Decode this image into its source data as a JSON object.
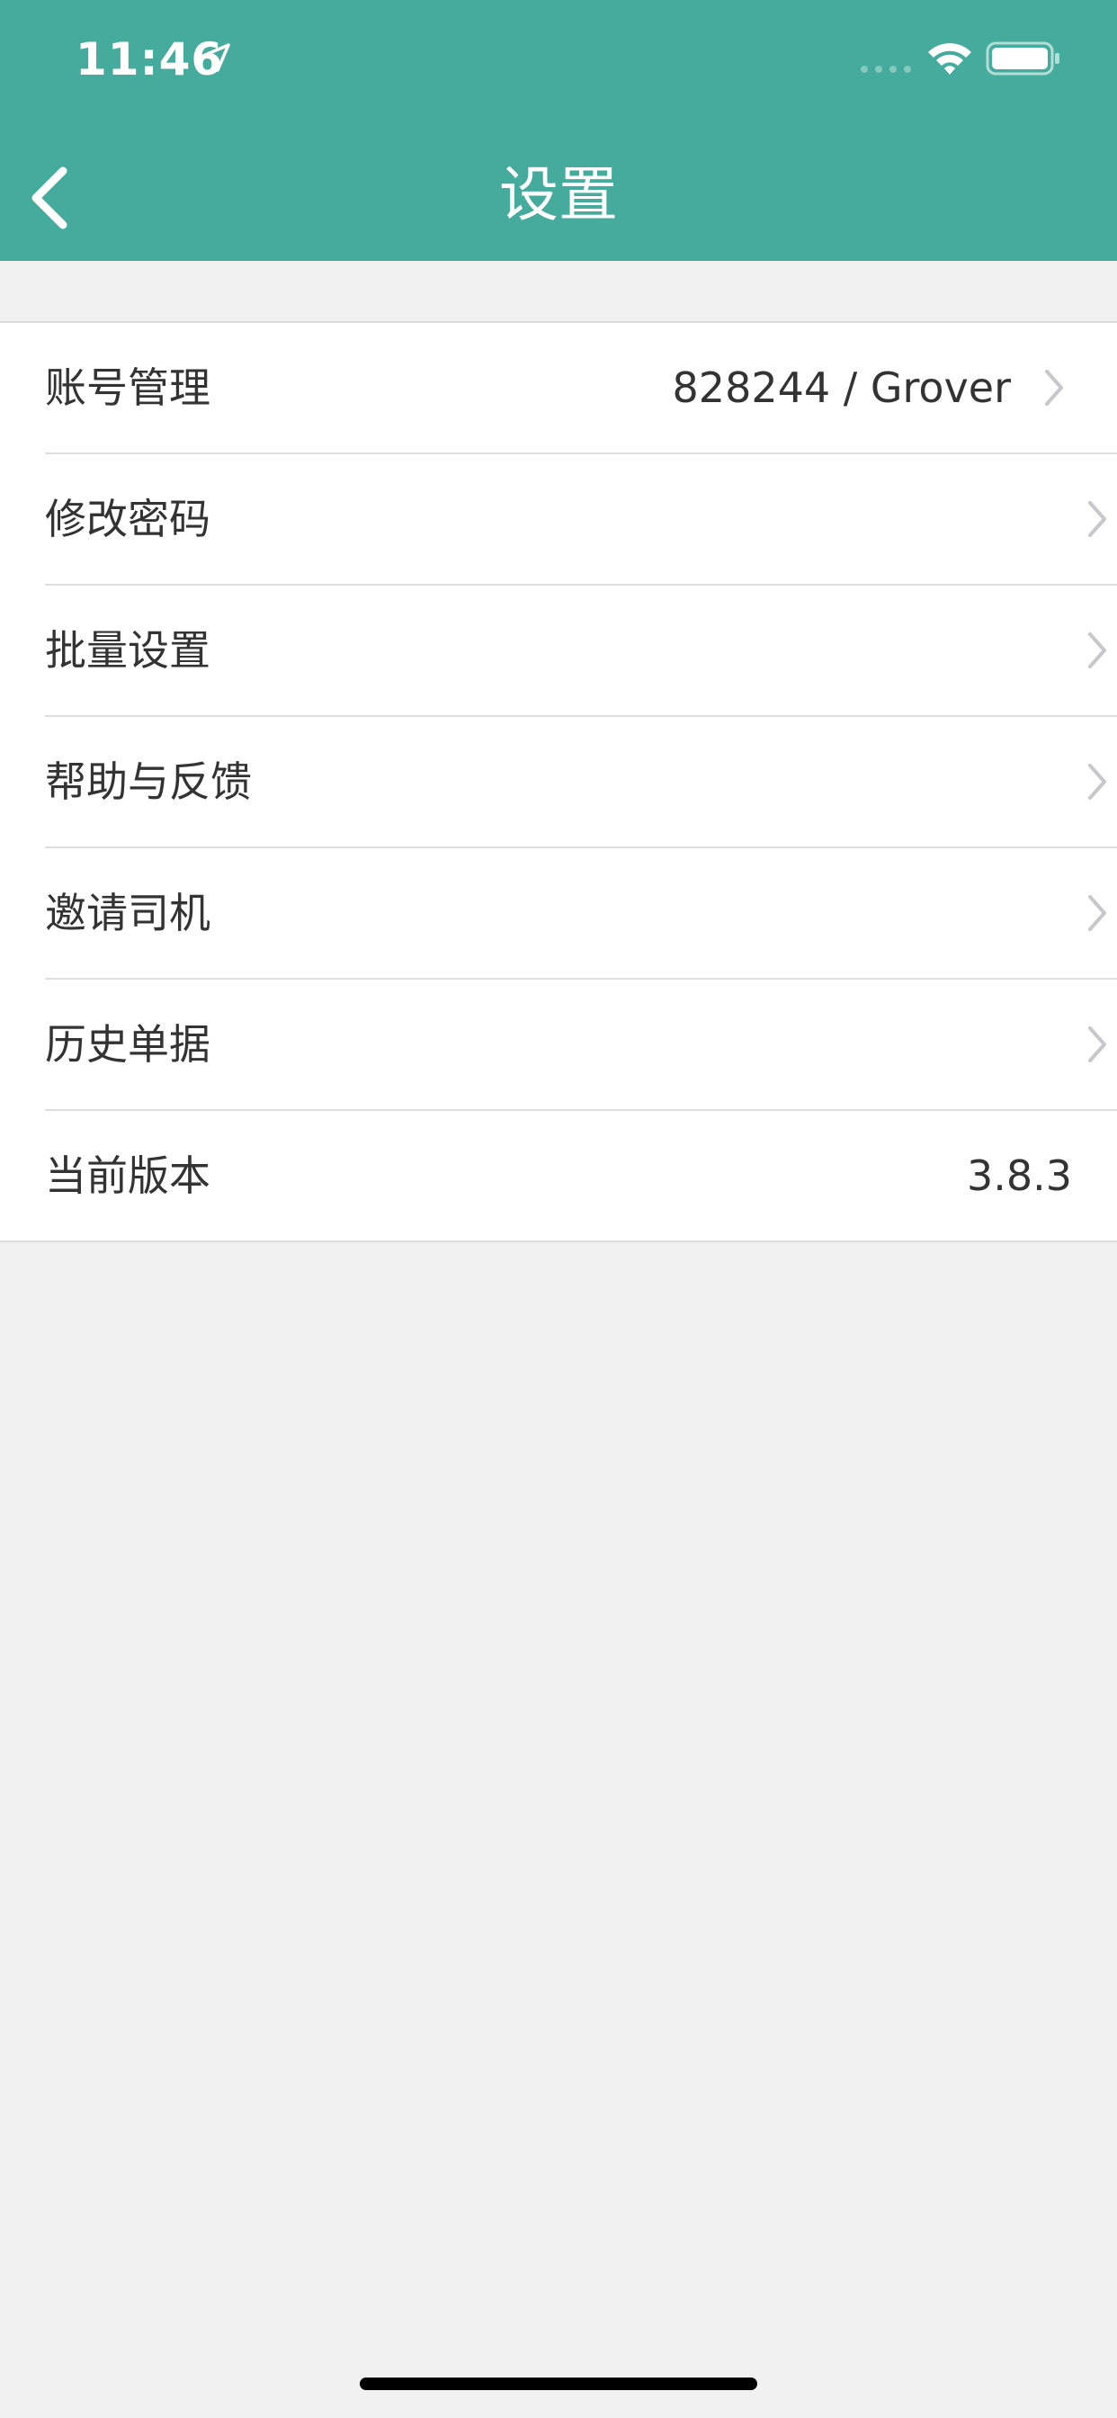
{
  "status_bar": {
    "time": "11:46"
  },
  "nav": {
    "title": "设置"
  },
  "settings": {
    "items": [
      {
        "label": "账号管理",
        "value": "828244 / Grover"
      },
      {
        "label": "修改密码",
        "value": ""
      },
      {
        "label": "批量设置",
        "value": ""
      },
      {
        "label": "帮助与反馈",
        "value": ""
      },
      {
        "label": "邀请司机",
        "value": ""
      },
      {
        "label": "历史单据",
        "value": ""
      },
      {
        "label": "当前版本",
        "value": "3.8.3"
      }
    ]
  },
  "colors": {
    "header_bg": "#44ab9d",
    "page_bg": "#f1f1f1",
    "text": "#333333",
    "chevron": "#c7c7cc"
  },
  "icons": [
    "location-arrow-icon",
    "wifi-icon",
    "battery-icon",
    "chevron-left-icon",
    "chevron-right-icon"
  ]
}
